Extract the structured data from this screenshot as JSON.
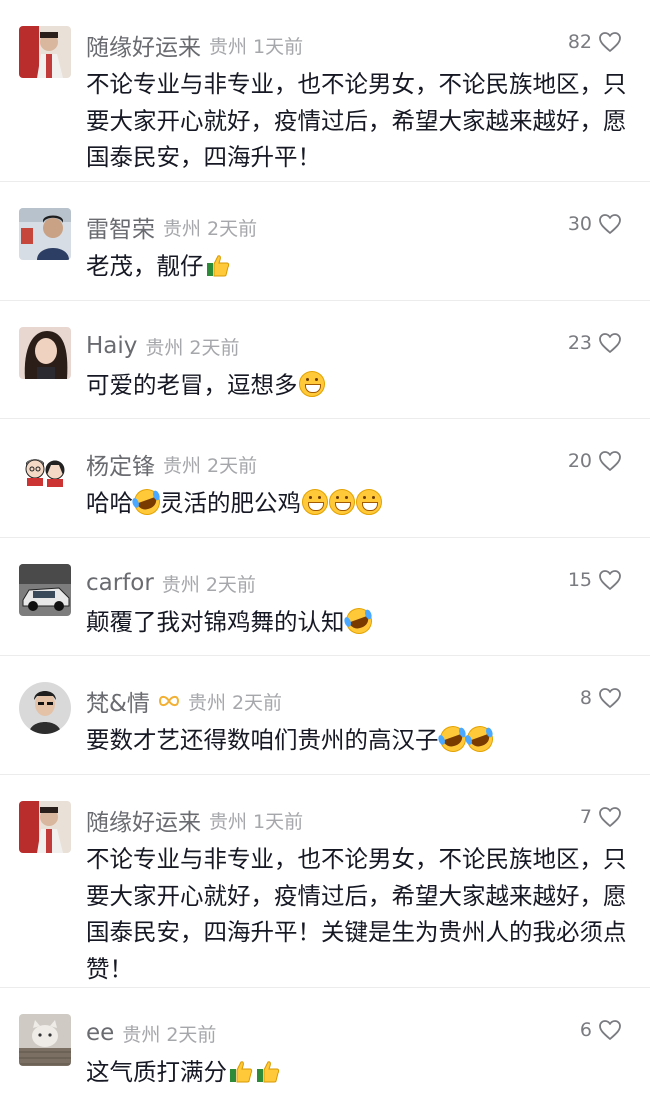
{
  "comments": [
    {
      "username": "随缘好运来",
      "region": "贵州",
      "time": "1天前",
      "likes": "82",
      "text": "不论专业与非专业，也不论男女，不论民族地区，只要大家开心就好，疫情过后，希望大家越来越好，愿国泰民安，四海升平！",
      "emojis": [],
      "avatar": "red-robed-figure-avatar"
    },
    {
      "username": "雷智荣",
      "region": "贵州",
      "time": "2天前",
      "likes": "30",
      "text": "老茂，靓仔",
      "emojis": [
        "thumbs-up"
      ],
      "avatar": "man-portrait-avatar"
    },
    {
      "username": "Haiy",
      "region": "贵州",
      "time": "2天前",
      "likes": "23",
      "text": "可爱的老冒，逗想多",
      "emojis": [
        "grin"
      ],
      "avatar": "woman-portrait-avatar"
    },
    {
      "username": "杨定锋",
      "region": "贵州",
      "time": "2天前",
      "likes": "20",
      "text": "哈哈",
      "text_after": "灵活的肥公鸡",
      "emojis": [
        "laugh-cry"
      ],
      "emojis_after": [
        "grin",
        "grin",
        "grin"
      ],
      "avatar": "cartoon-couple-avatar"
    },
    {
      "username": "carfor",
      "region": "贵州",
      "time": "2天前",
      "likes": "15",
      "text": "颠覆了我对锦鸡舞的认知",
      "emojis": [
        "laugh-cry"
      ],
      "avatar": "car-avatar"
    },
    {
      "username": "梵&情",
      "region": "贵州",
      "time": "2天前",
      "likes": "8",
      "text": "要数才艺还得数咱们贵州的高汉子",
      "emojis": [
        "laugh-cry",
        "laugh-cry"
      ],
      "avatar": "round-man-avatar",
      "badge": "infinity-icon"
    },
    {
      "username": "随缘好运来",
      "region": "贵州",
      "time": "1天前",
      "likes": "7",
      "text": "不论专业与非专业，也不论男女，不论民族地区，只要大家开心就好，疫情过后，希望大家越来越好，愿国泰民安，四海升平！关键是生为贵州人的我必须点赞！",
      "emojis": [],
      "avatar": "red-robed-figure-avatar"
    },
    {
      "username": "ee",
      "region": "贵州",
      "time": "2天前",
      "likes": "6",
      "text": "这气质打满分",
      "emojis": [
        "thumbs-up",
        "thumbs-up"
      ],
      "avatar": "cat-avatar"
    }
  ],
  "colors": {
    "username": "#6a6b70",
    "meta": "#a6a7ab",
    "text": "#161823",
    "divider": "#ececec"
  }
}
